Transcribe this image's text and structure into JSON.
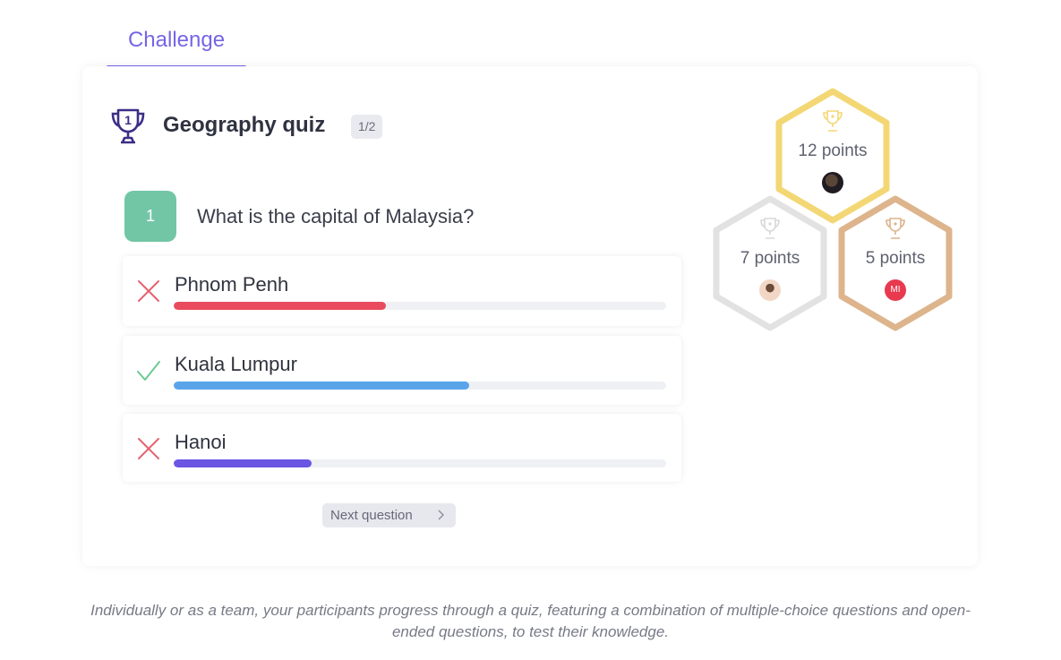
{
  "tab": {
    "label": "Challenge"
  },
  "quiz": {
    "title": "Geography quiz",
    "counter": "1/2",
    "trophy_number": "1"
  },
  "question": {
    "number": "1",
    "text": "What is the capital of Malaysia?"
  },
  "answers": [
    {
      "label": "Phnom Penh",
      "status": "incorrect",
      "share": 0.43,
      "color": "#ea4a5d"
    },
    {
      "label": "Kuala Lumpur",
      "status": "correct",
      "share": 0.6,
      "color": "#5aa4ea"
    },
    {
      "label": "Hanoi",
      "status": "incorrect",
      "share": 0.28,
      "color": "#6b55e3"
    }
  ],
  "next_button": {
    "label": "Next question"
  },
  "leaderboard": [
    {
      "rank": 1,
      "points": "12 points",
      "color": "#f3d774",
      "avatar": "photo-avatar-dark"
    },
    {
      "rank": 2,
      "points": "7 points",
      "color": "#e2e2e2",
      "avatar": "photo-avatar-light"
    },
    {
      "rank": 3,
      "points": "5 points",
      "color": "#ddb48c",
      "avatar": "initials-avatar",
      "initials": "MI"
    }
  ],
  "caption": "Individually or as a team, your participants progress through a quiz, featuring a combination of multiple-choice questions and open-ended questions, to test their knowledge.",
  "colors": {
    "accent": "#7565e6",
    "question_badge": "#72c6a5",
    "correct": "#6cc991",
    "incorrect": "#e5626f"
  }
}
